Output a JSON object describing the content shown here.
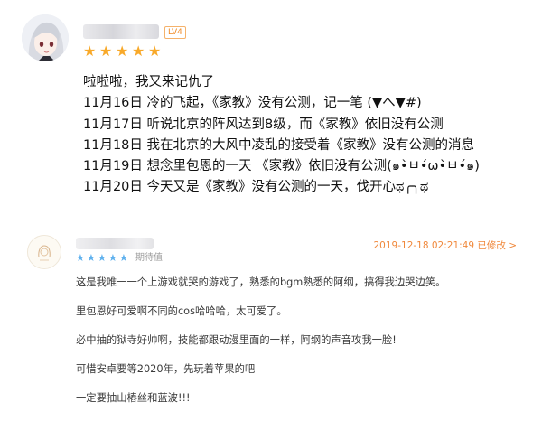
{
  "review1": {
    "level_badge": "LV4",
    "star_count": 5,
    "lines": [
      "啦啦啦，我又来记仇了",
      "11月16日 冷的飞起，《家教》没有公测，记一笔 (▼へ▼#)",
      "11月17日 听说北京的阵风达到8级，而《家教》依旧没有公测",
      "11月18日  我在北京的大风中凌乱的接受着《家教》没有公测的消息",
      "11月19日   想念里包恩的一天 《家教》依旧没有公测(๑•̀ㅂ•́ω•̀ㅂ•́๑)",
      "11月20日       今天又是《家教》没有公测的一天，伐开心ಥ╭╮ಥ"
    ]
  },
  "review2": {
    "date_text": "2019-12-18 02:21:49 已修改 >",
    "expect_label": "期待值",
    "star_count": 5,
    "lines": [
      "这是我唯一一个上游戏就哭的游戏了，熟悉的bgm熟悉的阿纲，搞得我边哭边笑。",
      "里包恩好可爱啊不同的cos哈哈哈，太可爱了。",
      "必中抽的狱寺好帅啊，技能都跟动漫里面的一样，阿纲的声音攻我一脸!",
      "可惜安卓要等2020年，先玩着苹果的吧",
      "一定要抽山樁丝和蓝波!!!"
    ]
  },
  "colors": {
    "star_orange": "#f8a92a",
    "star_blue": "#5fb1ee",
    "date_orange": "#f0883b"
  }
}
